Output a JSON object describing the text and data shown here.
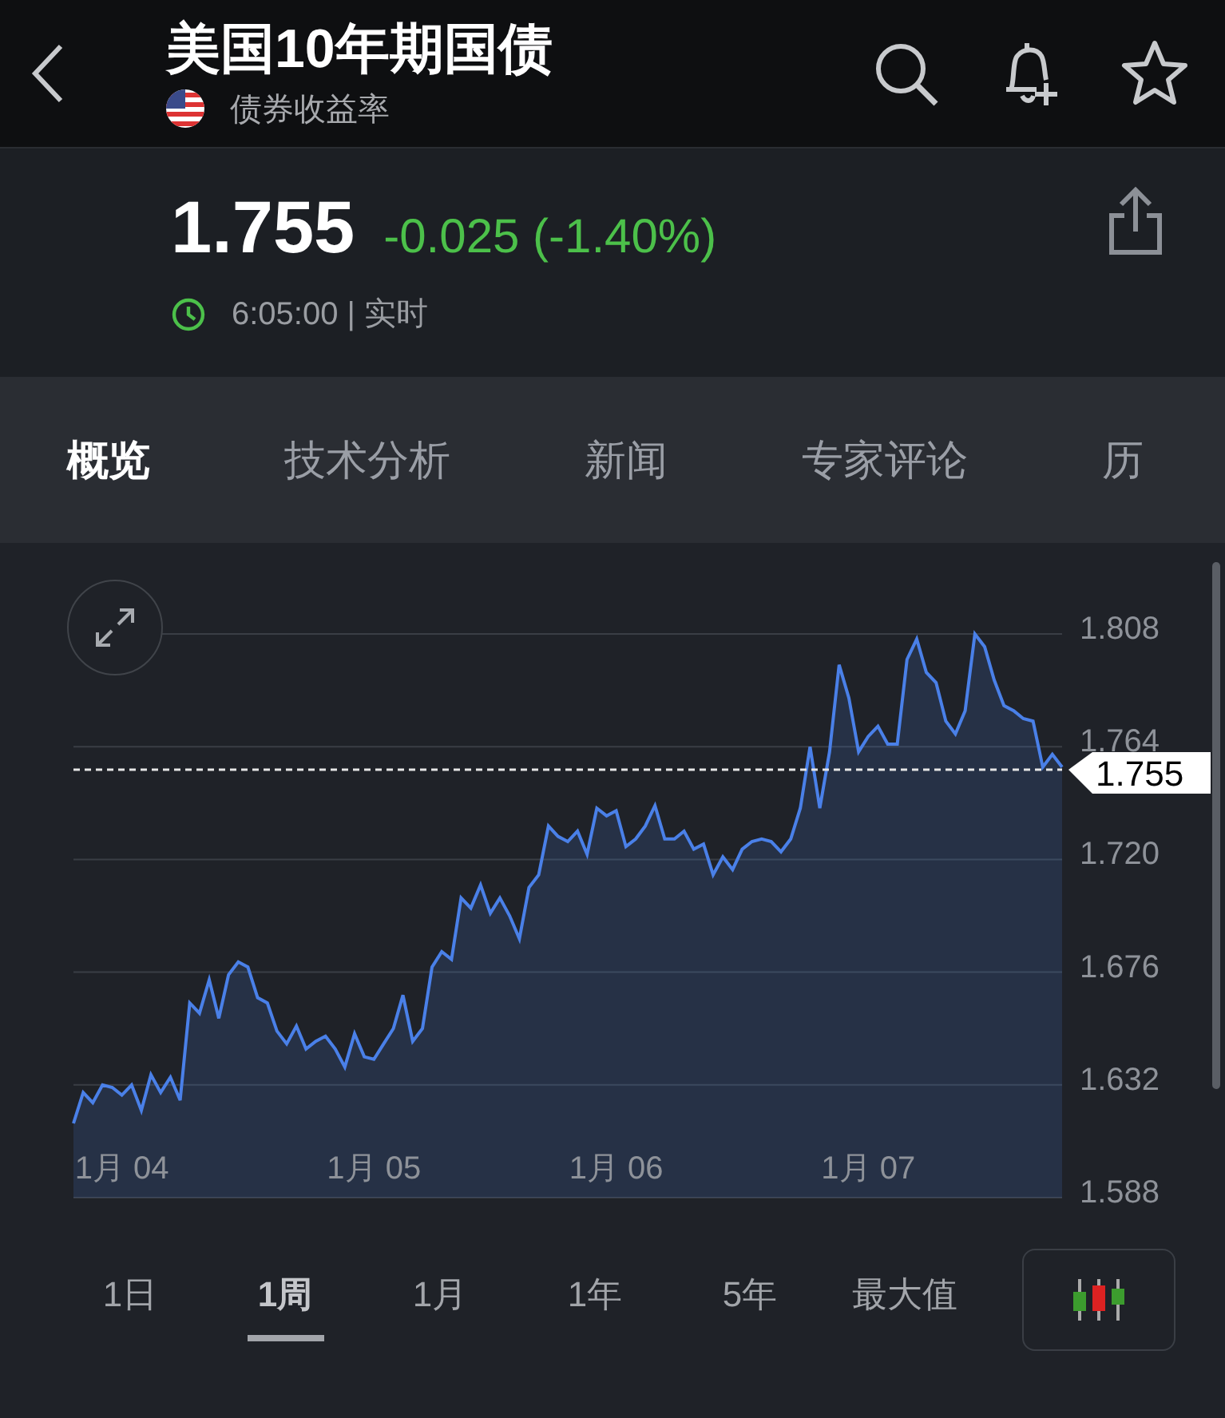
{
  "header": {
    "title": "美国10年期国债",
    "subtitle": "债券收益率"
  },
  "quote": {
    "price": "1.755",
    "change": "-0.025 (-1.40%)",
    "time": "6:05:00 | 实时"
  },
  "tabs": [
    {
      "label": "概览",
      "selected": true
    },
    {
      "label": "技术分析",
      "selected": false
    },
    {
      "label": "新闻",
      "selected": false
    },
    {
      "label": "专家评论",
      "selected": false
    },
    {
      "label": "历",
      "selected": false
    }
  ],
  "chart": {
    "chart_data": {
      "type": "area",
      "categories": [
        null,
        null,
        null,
        null,
        null,
        "1月 04",
        null,
        null,
        null,
        null,
        null,
        null,
        null,
        null,
        null,
        null,
        null,
        null,
        null,
        null,
        null,
        null,
        null,
        null,
        null,
        null,
        null,
        null,
        null,
        null,
        null,
        "1月 05",
        null,
        null,
        null,
        null,
        null,
        null,
        null,
        null,
        null,
        null,
        null,
        null,
        null,
        null,
        null,
        null,
        null,
        null,
        null,
        null,
        null,
        null,
        null,
        null,
        "1月 06",
        null,
        null,
        null,
        null,
        null,
        null,
        null,
        null,
        null,
        null,
        null,
        null,
        null,
        null,
        null,
        null,
        null,
        null,
        null,
        null,
        null,
        null,
        null,
        null,
        null,
        "1月 07",
        null,
        null,
        null,
        null,
        null,
        null,
        null,
        null,
        null,
        null,
        null,
        null,
        null,
        null,
        null,
        null,
        null,
        null,
        null,
        null
      ],
      "grid": true,
      "series": [
        {
          "color": "#4a80e8",
          "values": [
            1.617,
            1.629,
            1.625,
            1.632,
            1.631,
            1.628,
            1.632,
            1.622,
            1.636,
            1.629,
            1.635,
            1.626,
            1.664,
            1.66,
            1.673,
            1.658,
            1.675,
            1.68,
            1.678,
            1.666,
            1.664,
            1.653,
            1.648,
            1.655,
            1.646,
            1.649,
            1.651,
            1.646,
            1.639,
            1.652,
            1.643,
            1.642,
            1.648,
            1.654,
            1.667,
            1.649,
            1.654,
            1.678,
            1.684,
            1.681,
            1.705,
            1.701,
            1.71,
            1.699,
            1.705,
            1.698,
            1.689,
            1.709,
            1.714,
            1.733,
            1.729,
            1.727,
            1.731,
            1.722,
            1.74,
            1.737,
            1.739,
            1.725,
            1.728,
            1.733,
            1.741,
            1.728,
            1.728,
            1.731,
            1.724,
            1.726,
            1.714,
            1.721,
            1.716,
            1.724,
            1.727,
            1.728,
            1.727,
            1.723,
            1.728,
            1.74,
            1.764,
            1.74,
            1.762,
            1.796,
            1.783,
            1.762,
            1.768,
            1.772,
            1.765,
            1.765,
            1.798,
            1.806,
            1.793,
            1.789,
            1.774,
            1.769,
            1.778,
            1.808,
            1.803,
            1.79,
            1.78,
            1.778,
            1.775,
            1.774,
            1.756,
            1.761,
            1.756
          ]
        }
      ],
      "ylim": [
        1.588,
        1.808
      ],
      "yticks": [
        {
          "value": 1.808,
          "label": "1.808"
        },
        {
          "value": 1.764,
          "label": "1.764"
        },
        {
          "value": 1.72,
          "label": "1.720"
        },
        {
          "value": 1.676,
          "label": "1.676"
        },
        {
          "value": 1.632,
          "label": "1.632"
        },
        {
          "value": 1.588,
          "label": "1.588"
        }
      ],
      "ref_lines": [
        {
          "axis": "y",
          "value": 1.755,
          "label": "1.755"
        }
      ]
    }
  },
  "ranges": [
    {
      "label": "1日",
      "selected": false
    },
    {
      "label": "1周",
      "selected": true
    },
    {
      "label": "1月",
      "selected": false
    },
    {
      "label": "1年",
      "selected": false
    },
    {
      "label": "5年",
      "selected": false
    },
    {
      "label": "最大值",
      "selected": false
    }
  ]
}
